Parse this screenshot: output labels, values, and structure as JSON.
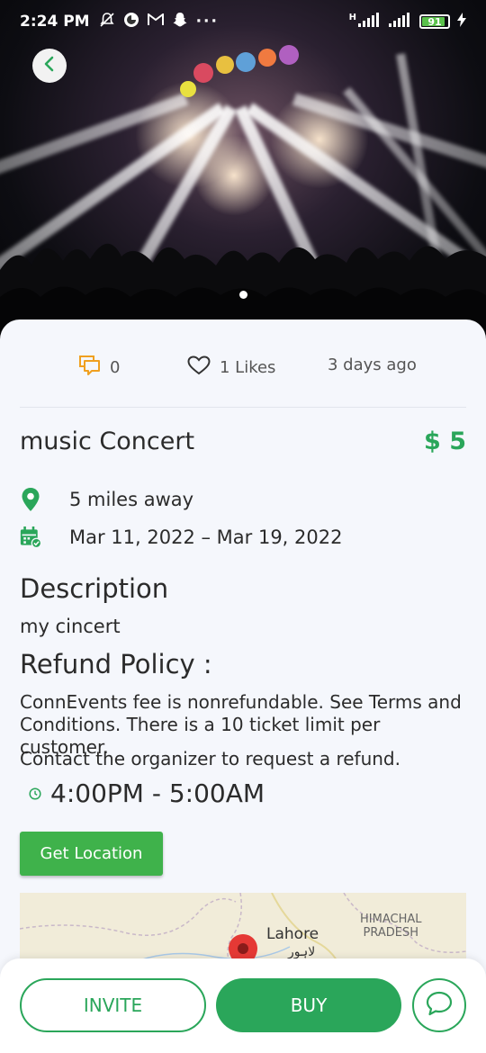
{
  "status_bar": {
    "time": "2:24 PM",
    "network": "H",
    "battery": "91"
  },
  "event": {
    "comments_count": "0",
    "likes": "1 Likes",
    "posted": "3 days ago",
    "title": "music Concert",
    "price": "$ 5",
    "distance": "5 miles away",
    "dates": "Mar 11, 2022 – Mar 19, 2022",
    "description_heading": "Description",
    "description": "my cincert",
    "refund_heading": "Refund Policy :",
    "refund_text": "ConnEvents fee is nonrefundable. See Terms and Conditions. There is a 10 ticket limit per customer.",
    "refund_contact": "Contact the organizer to request a refund.",
    "time_range": "4:00PM - 5:00AM"
  },
  "actions": {
    "get_location": "Get Location",
    "invite": "INVITE",
    "buy": "BUY"
  },
  "map": {
    "city": "Lahore",
    "city_local": "لاہور",
    "region_line1": "HIMACHAL",
    "region_line2": "PRADESH"
  },
  "colors": {
    "accent": "#2aa65a",
    "location_button": "#3fb24b",
    "comment_icon": "#f0a020"
  }
}
